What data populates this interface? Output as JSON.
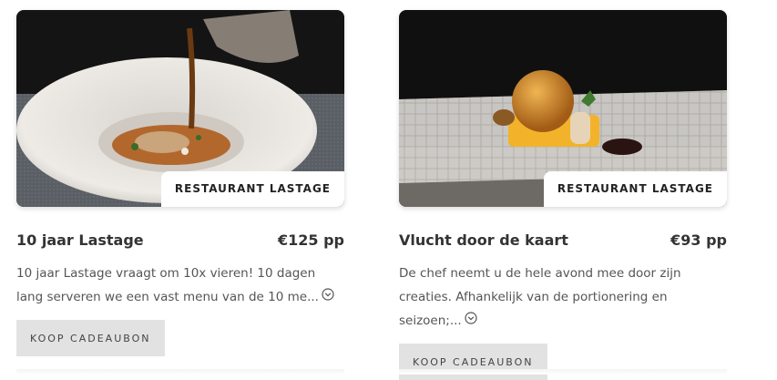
{
  "cards": [
    {
      "badge": "RESTAURANT LASTAGE",
      "title": "10 jaar Lastage",
      "price": "€125 pp",
      "description": "10 jaar Lastage vraagt om 10x vieren! 10 dagen lang serveren we een vast menu van de 10 me...",
      "more_icon": "chevron-circle-down",
      "button": "KOOP CADEAUBON"
    },
    {
      "badge": "RESTAURANT LASTAGE",
      "title": "Vlucht door de kaart",
      "price": "€93 pp",
      "description": "De chef neemt u de hele avond mee door zijn creaties. Afhankelijk van de portionering en seizoen;...",
      "more_icon": "chevron-circle-down",
      "button": "KOOP CADEAUBON"
    }
  ]
}
